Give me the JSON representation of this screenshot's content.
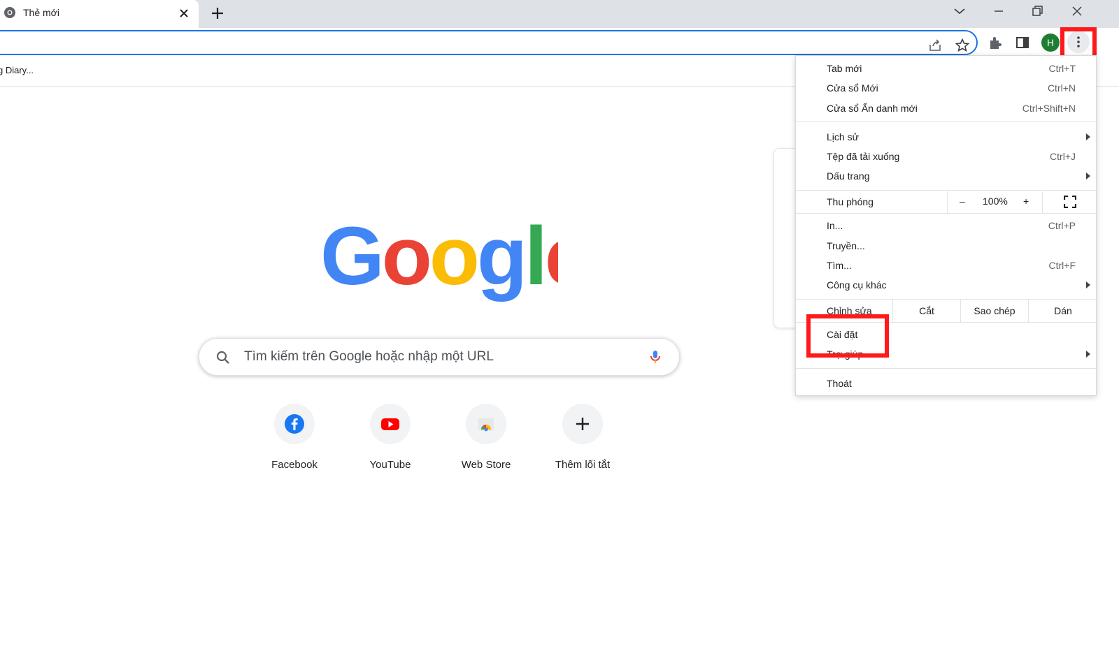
{
  "tab": {
    "title": "Thẻ mới"
  },
  "bookmark_bar": {
    "item": "g Diary..."
  },
  "ntp": {
    "search_placeholder": "Tìm kiếm trên Google hoặc nhập một URL",
    "shortcuts": [
      {
        "label": "Facebook",
        "icon": "facebook-icon"
      },
      {
        "label": "YouTube",
        "icon": "youtube-icon"
      },
      {
        "label": "Web Store",
        "icon": "web-store-icon"
      },
      {
        "label": "Thêm lối tắt",
        "icon": "plus-icon"
      }
    ]
  },
  "profile": {
    "initial": "H",
    "color": "#1e7d32"
  },
  "menu": {
    "new_tab": {
      "label": "Tab mới",
      "shortcut": "Ctrl+T"
    },
    "new_window": {
      "label": "Cửa sổ Mới",
      "shortcut": "Ctrl+N"
    },
    "incognito": {
      "label": "Cửa sổ Ẩn danh mới",
      "shortcut": "Ctrl+Shift+N"
    },
    "history": {
      "label": "Lịch sử"
    },
    "downloads": {
      "label": "Tệp đã tải xuống",
      "shortcut": "Ctrl+J"
    },
    "bookmarks": {
      "label": "Dấu trang"
    },
    "zoom": {
      "label": "Thu phóng",
      "minus": "–",
      "value": "100%",
      "plus": "+"
    },
    "print": {
      "label": "In...",
      "shortcut": "Ctrl+P"
    },
    "cast": {
      "label": "Truyền..."
    },
    "find": {
      "label": "Tìm...",
      "shortcut": "Ctrl+F"
    },
    "more_tools": {
      "label": "Công cụ khác"
    },
    "edit": {
      "label": "Chỉnh sửa",
      "cut": "Cắt",
      "copy": "Sao chép",
      "paste": "Dán"
    },
    "settings": {
      "label": "Cài đặt"
    },
    "help": {
      "label": "Trợ giúp"
    },
    "exit": {
      "label": "Thoát"
    }
  },
  "colors": {
    "highlight": "#ff1a1a",
    "accent": "#1a73e8"
  }
}
